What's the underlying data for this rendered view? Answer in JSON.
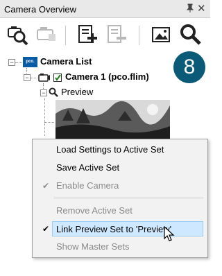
{
  "panel": {
    "title": "Camera Overview",
    "pin_glyph": "p",
    "close_glyph": "✕"
  },
  "toolbar": {
    "buttons": [
      {
        "icon": "find-camera-icon",
        "enabled": true
      },
      {
        "icon": "camera-connect-icon",
        "enabled": false
      },
      {
        "icon": "add-set-icon",
        "enabled": true
      },
      {
        "icon": "remove-set-icon",
        "enabled": false
      },
      {
        "icon": "image-view-icon",
        "enabled": true
      },
      {
        "icon": "zoom-preview-icon",
        "enabled": true
      }
    ]
  },
  "tree": {
    "root": {
      "label": "Camera List",
      "logo_text": "pco."
    },
    "camera": {
      "label": "Camera 1 (pco.flim)",
      "checked": true
    },
    "preview": {
      "label": "Preview"
    }
  },
  "badge": {
    "number": "8",
    "color": "#0b5b78"
  },
  "context_menu": {
    "items": [
      {
        "label": "Load Settings to Active Set",
        "enabled": true,
        "checked": false
      },
      {
        "label": "Save Active Set",
        "enabled": true,
        "checked": false
      },
      {
        "label": "Enable Camera",
        "enabled": false,
        "checked": true
      },
      {
        "label": "Remove Active Set",
        "enabled": false,
        "checked": false
      },
      {
        "label": "Link Preview Set to 'Preview'",
        "enabled": true,
        "checked": true,
        "hovered": true
      },
      {
        "label": "Show Master Sets",
        "enabled": false,
        "checked": false
      }
    ],
    "check_glyph": "✔"
  },
  "colors": {
    "hover_bg": "#cde8ff",
    "hover_border": "#99ccf3",
    "logo_blue": "#0a5ba6"
  }
}
